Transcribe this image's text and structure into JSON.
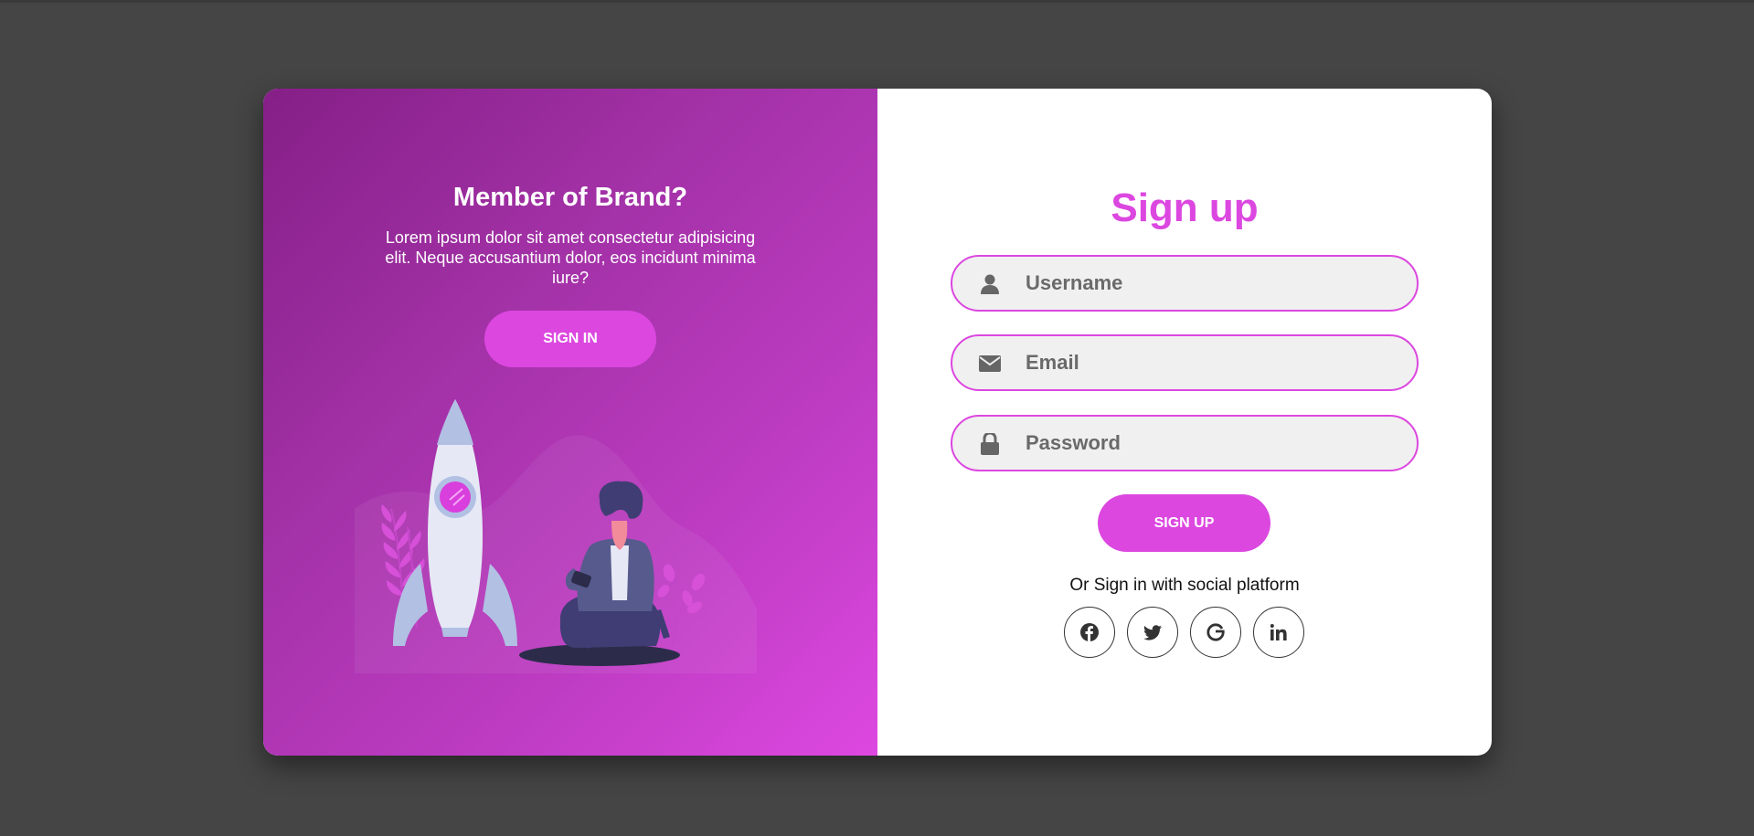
{
  "colors": {
    "accent": "#dc47e0",
    "panel_gradient_start": "#851f87",
    "panel_gradient_end": "#dd48e0",
    "page_background": "#454545"
  },
  "left_panel": {
    "heading": "Member of Brand?",
    "text": "Lorem ipsum dolor sit amet consectetur adipisicing elit. Neque accusantium dolor, eos incidunt minima iure?",
    "button_label": "Sign in",
    "illustration": "rocket-and-person-illustration"
  },
  "signup_form": {
    "title": "Sign up",
    "fields": [
      {
        "icon": "user-icon",
        "placeholder": "Username",
        "value": ""
      },
      {
        "icon": "envelope-icon",
        "placeholder": "Email",
        "value": ""
      },
      {
        "icon": "lock-icon",
        "placeholder": "Password",
        "value": ""
      }
    ],
    "submit_label": "Sign up",
    "social_text": "Or Sign in with social platform",
    "social_icons": [
      "facebook-icon",
      "twitter-icon",
      "google-icon",
      "linkedin-icon"
    ]
  }
}
